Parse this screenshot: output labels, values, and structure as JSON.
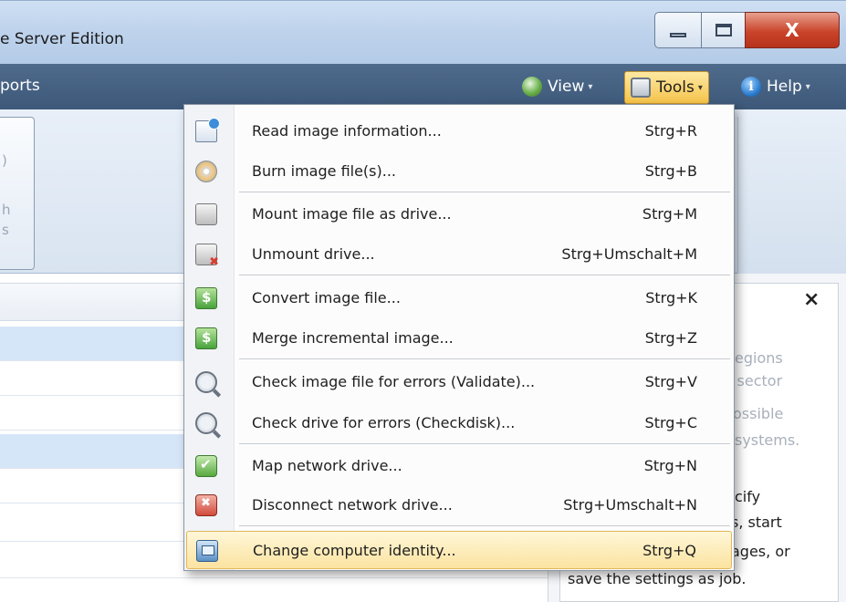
{
  "window": {
    "title": "e Server Edition",
    "close_glyph": "X"
  },
  "menubar": {
    "reports": "ports",
    "view": "View",
    "tools": "Tools",
    "help": "Help"
  },
  "ribbon": {
    "frag1": ")",
    "frag2": "h",
    "frag3": "s"
  },
  "tools_menu": {
    "items": [
      {
        "label": "Read image information...",
        "shortcut": "Strg+R",
        "icon": "read-info-icon"
      },
      {
        "label": "Burn image file(s)...",
        "shortcut": "Strg+B",
        "icon": "burn-disc-icon"
      },
      {
        "label": "Mount image file as drive...",
        "shortcut": "Strg+M",
        "icon": "mount-drive-icon"
      },
      {
        "label": "Unmount drive...",
        "shortcut": "Strg+Umschalt+M",
        "icon": "unmount-drive-icon"
      },
      {
        "label": "Convert image file...",
        "shortcut": "Strg+K",
        "icon": "convert-icon"
      },
      {
        "label": "Merge incremental image...",
        "shortcut": "Strg+Z",
        "icon": "merge-icon"
      },
      {
        "label": "Check image file for errors (Validate)...",
        "shortcut": "Strg+V",
        "icon": "validate-icon"
      },
      {
        "label": "Check drive for errors (Checkdisk)...",
        "shortcut": "Strg+C",
        "icon": "checkdisk-icon"
      },
      {
        "label": "Map network drive...",
        "shortcut": "Strg+N",
        "icon": "map-network-icon"
      },
      {
        "label": "Disconnect network drive...",
        "shortcut": "Strg+Umschalt+N",
        "icon": "disconnect-network-icon"
      },
      {
        "label": "Change computer identity...",
        "shortcut": "Strg+Q",
        "icon": "computer-identity-icon"
      }
    ]
  },
  "info_panel": {
    "close": "×",
    "lines_gray": [
      "egions",
      "l sector",
      "ossible",
      "systems."
    ],
    "lines_dark": [
      "cify",
      "s, start",
      "ages, or",
      "save the settings as job."
    ]
  },
  "colors": {
    "menubar": "#3d5879",
    "highlight": "#fbe3a0",
    "selected_row": "#d6e6f9"
  }
}
